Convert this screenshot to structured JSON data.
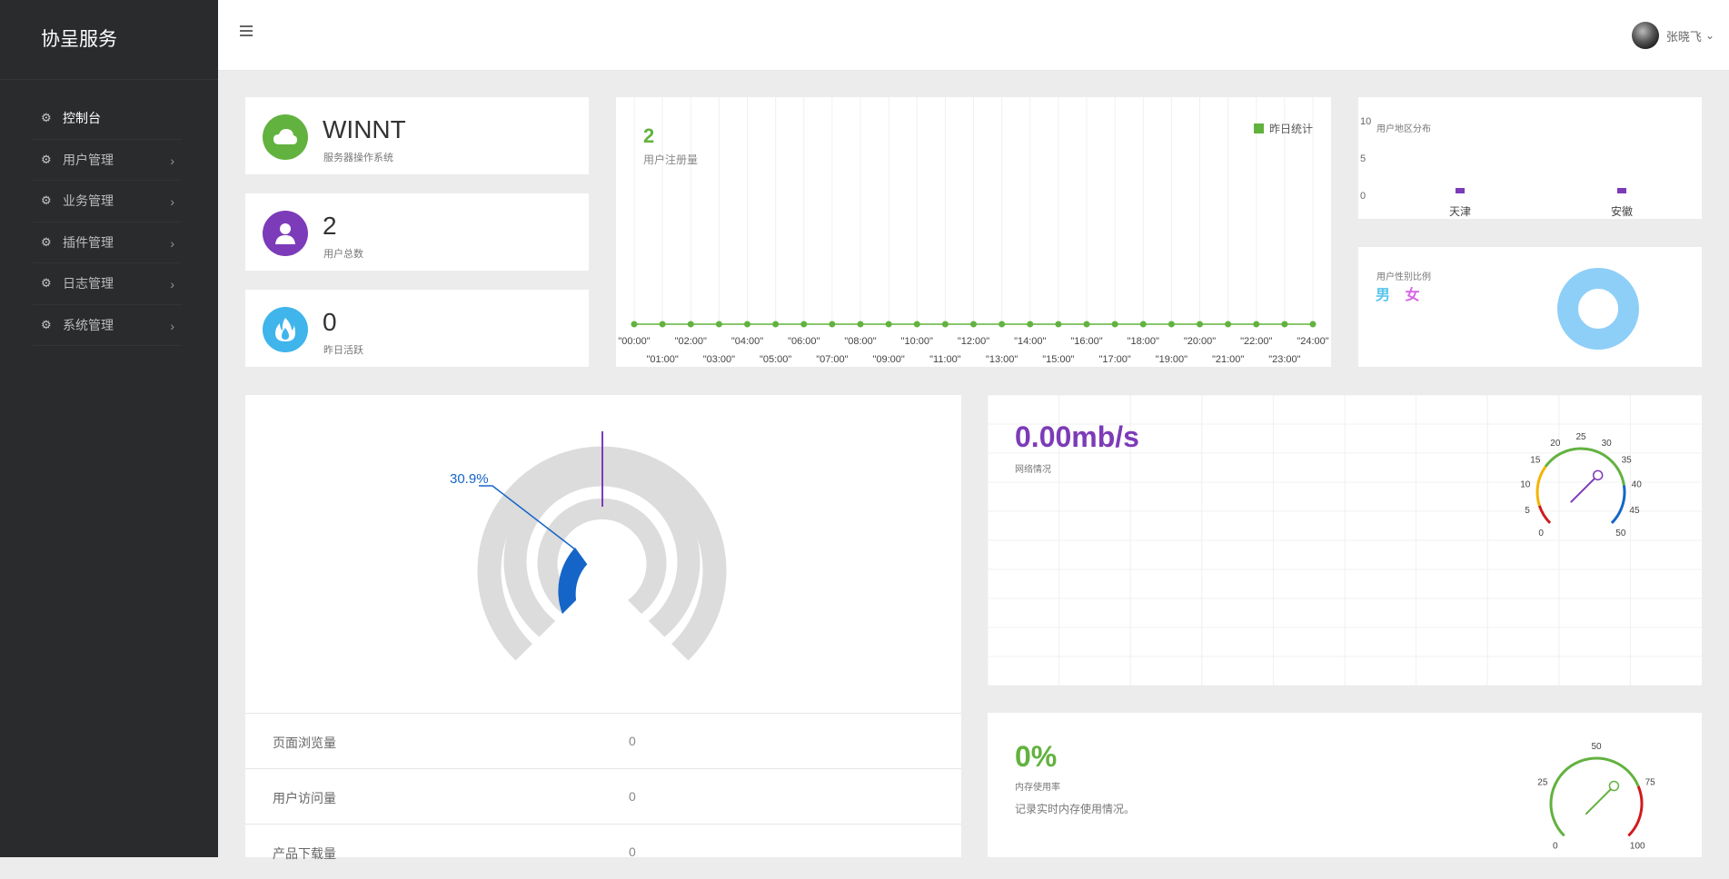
{
  "sidebar": {
    "title": "协呈服务",
    "items": [
      {
        "label": "控制台",
        "active": true,
        "arrow": false
      },
      {
        "label": "用户管理",
        "active": false,
        "arrow": true
      },
      {
        "label": "业务管理",
        "active": false,
        "arrow": true
      },
      {
        "label": "插件管理",
        "active": false,
        "arrow": true
      },
      {
        "label": "日志管理",
        "active": false,
        "arrow": true
      },
      {
        "label": "系统管理",
        "active": false,
        "arrow": true
      }
    ]
  },
  "topbar": {
    "user_name": "张晓飞"
  },
  "stats": [
    {
      "value": "WINNT",
      "label": "服务器操作系统",
      "color": "#62b23f",
      "icon": "cloud-icon"
    },
    {
      "value": "2",
      "label": "用户总数",
      "color": "#7c3bb8",
      "icon": "user-icon"
    },
    {
      "value": "0",
      "label": "昨日活跃",
      "color": "#3fb5eb",
      "icon": "fire-icon"
    }
  ],
  "registration": {
    "value": "2",
    "label": "用户注册量",
    "legend": "昨日统计",
    "hours_top": [
      "\"00:00\"",
      "\"02:00\"",
      "\"04:00\"",
      "\"06:00\"",
      "\"08:00\"",
      "\"10:00\"",
      "\"12:00\"",
      "\"14:00\"",
      "\"16:00\"",
      "\"18:00\"",
      "\"20:00\"",
      "\"22:00\"",
      "\"24:00\""
    ],
    "hours_bottom": [
      "\"01:00\"",
      "\"03:00\"",
      "\"05:00\"",
      "\"07:00\"",
      "\"09:00\"",
      "\"11:00\"",
      "\"13:00\"",
      "\"15:00\"",
      "\"17:00\"",
      "\"19:00\"",
      "\"21:00\"",
      "\"23:00\""
    ]
  },
  "region": {
    "title": "用户地区分布",
    "ticks": [
      "10",
      "5",
      "0"
    ],
    "categories": [
      "天津",
      "安徽"
    ]
  },
  "gender": {
    "title": "用户性别比例",
    "male": "男",
    "female": "女"
  },
  "gauge_main": {
    "label": "30.9%"
  },
  "table": [
    {
      "key": "页面浏览量",
      "value": "0"
    },
    {
      "key": "用户访问量",
      "value": "0"
    },
    {
      "key": "产品下载量",
      "value": "0"
    }
  ],
  "network": {
    "value": "0.00mb/s",
    "label": "网络情况",
    "ticks": [
      "0",
      "5",
      "10",
      "15",
      "20",
      "25",
      "30",
      "35",
      "40",
      "45",
      "50"
    ]
  },
  "memory": {
    "value": "0%",
    "label": "内存使用率",
    "desc": "记录实时内存使用情况。",
    "ticks": [
      "0",
      "25",
      "50",
      "75",
      "100"
    ]
  },
  "chart_data": [
    {
      "type": "line",
      "title": "用户注册量",
      "series": [
        {
          "name": "昨日统计",
          "values": [
            0,
            0,
            0,
            0,
            0,
            0,
            0,
            0,
            0,
            0,
            0,
            0,
            0,
            0,
            0,
            0,
            0,
            0,
            0,
            0,
            0,
            0,
            0,
            0,
            0
          ]
        }
      ],
      "x": [
        "00:00",
        "01:00",
        "02:00",
        "03:00",
        "04:00",
        "05:00",
        "06:00",
        "07:00",
        "08:00",
        "09:00",
        "10:00",
        "11:00",
        "12:00",
        "13:00",
        "14:00",
        "15:00",
        "16:00",
        "17:00",
        "18:00",
        "19:00",
        "20:00",
        "21:00",
        "22:00",
        "23:00",
        "24:00"
      ],
      "legend": "top-right"
    },
    {
      "type": "bar",
      "title": "用户地区分布",
      "categories": [
        "天津",
        "安徽"
      ],
      "values": [
        0,
        0
      ],
      "ylim": [
        0,
        10
      ]
    },
    {
      "type": "pie",
      "title": "用户性别比例",
      "categories": [
        "男",
        "女"
      ],
      "values": [
        1,
        0
      ]
    }
  ]
}
